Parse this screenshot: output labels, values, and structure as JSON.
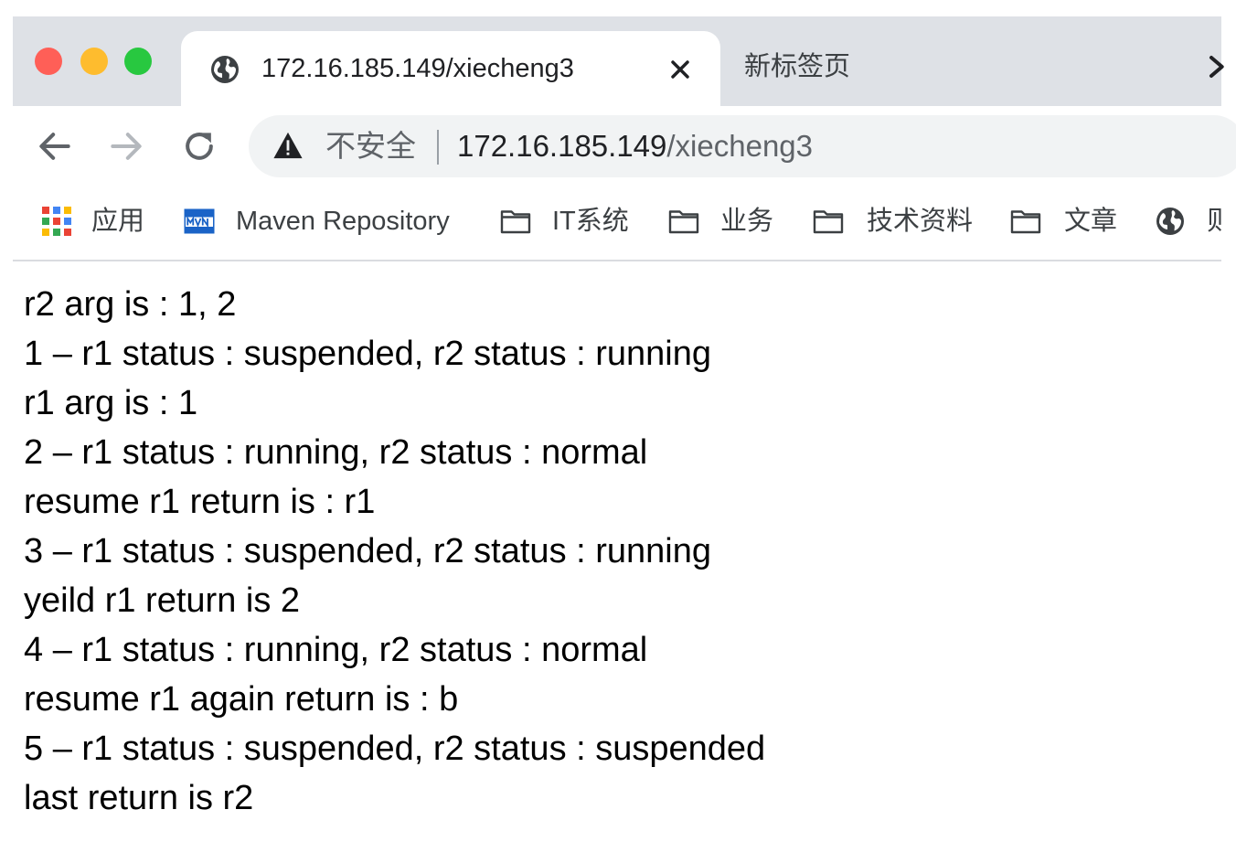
{
  "tabs": {
    "active_title": "172.16.185.149/xiecheng3",
    "inactive_title": "新标签页"
  },
  "toolbar": {
    "security_label": "不安全",
    "url_host": "172.16.185.149",
    "url_path": "/xiecheng3"
  },
  "bookmarks": [
    {
      "label": "应用",
      "icon": "apps-grid-icon"
    },
    {
      "label": "Maven Repository",
      "icon": "mvn-logo-icon"
    },
    {
      "label": "IT系统",
      "icon": "folder-icon"
    },
    {
      "label": "业务",
      "icon": "folder-icon"
    },
    {
      "label": "技术资料",
      "icon": "folder-icon"
    },
    {
      "label": "文章",
      "icon": "folder-icon"
    },
    {
      "label": "则",
      "icon": "globe-icon"
    }
  ],
  "content": {
    "lines": [
      "r2 arg is : 1, 2",
      "1 – r1 status : suspended, r2 status : running",
      "r1 arg is : 1",
      "2 – r1 status : running, r2 status : normal",
      "resume r1 return is : r1",
      "3 – r1 status : suspended, r2 status : running",
      "yeild r1 return is 2",
      "4 – r1 status : running, r2 status : normal",
      "resume r1 again return is : b",
      "5 – r1 status : suspended, r2 status : suspended",
      "last return is r2"
    ]
  },
  "colors": {
    "tabstrip_bg": "#dee1e6",
    "omnibox_bg": "#f1f3f4",
    "traffic_red": "#ff5f57",
    "traffic_yellow": "#febc2e",
    "traffic_green": "#28c840"
  }
}
